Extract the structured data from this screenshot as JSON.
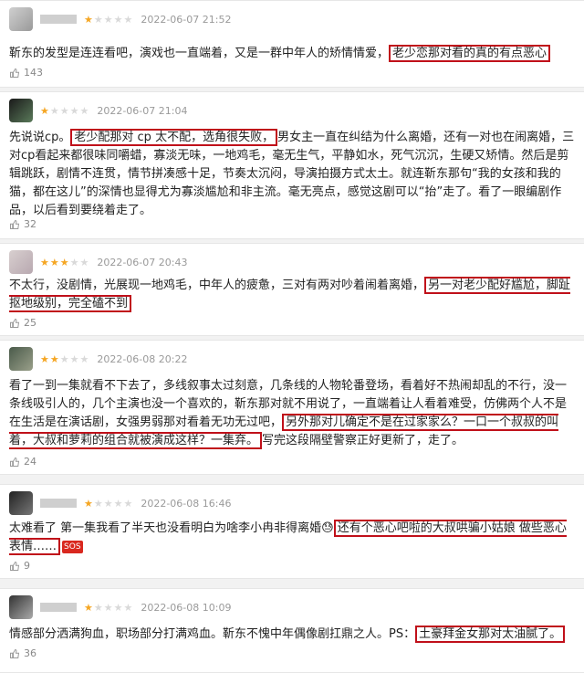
{
  "reviews": [
    {
      "date": "2022-06-07 21:52",
      "rating": 1,
      "text_before": "靳东的发型是连连看吧，演戏也一直端着，又是一群中年人的矫情情爱，",
      "highlight": "老少恋那对看的真的有点恶心",
      "text_after": "",
      "likes": "143"
    },
    {
      "date": "2022-06-07 21:04",
      "rating": 1,
      "text_before": "先说说cp。",
      "highlight": "老少配那对 cp 太不配，选角很失败，",
      "text_after": "男女主一直在纠结为什么离婚，还有一对也在闹离婚，三对cp看起来都很味同嚼蜡，寡淡无味，一地鸡毛，毫无生气，平静如水，死气沉沉，生硬又矫情。然后是剪辑跳跃，剧情不连贯，情节拼凑感十足，节奏太沉闷，导演拍摄方式太土。就连靳东那句“我的女孩和我的猫，都在这儿”的深情也显得尤为寡淡尴尬和非主流。毫无亮点，感觉这剧可以“抬”走了。看了一眼编剧作品，以后看到要绕着走了。",
      "likes": "32"
    },
    {
      "date": "2022-06-07 20:43",
      "rating": 3,
      "text_before": "不太行，没剧情，光展现一地鸡毛，中年人的疲惫，三对有两对吵着闹着离婚，",
      "highlight": "另一对老少配好尴尬，脚趾抠地级别，完全磕不到",
      "text_after": "",
      "likes": "25"
    },
    {
      "date": "2022-06-08 20:22",
      "rating": 2,
      "text_before": "看了一到一集就看不下去了，多线叙事太过刻意，几条线的人物轮番登场，看着好不热闹却乱的不行，没一条线吸引人的，几个主演也没一个喜欢的，靳东那对就不用说了，一直端着让人看着难受，仿佛两个人不是在生活是在演话剧，女强男弱那对看着无功无过吧，",
      "highlight": "另外那对儿确定不是在过家家么？一口一个叔叔的叫着，大叔和萝莉的组合就被演成这样？一集弃。",
      "text_after": "写完这段隔壁警察正好更新了，走了。",
      "likes": "24"
    },
    {
      "date": "2022-06-08 16:46",
      "rating": 1,
      "text_before": "太难看了 第一集我看了半天也没看明白为啥李小冉非得离婚😓",
      "highlight": "还有个恶心吧啦的大叔哄骗小姑娘 做些恶心表情……",
      "text_after": "",
      "sos": "SOS",
      "likes": "9"
    },
    {
      "date": "2022-06-08 10:09",
      "rating": 1,
      "text_before": "情感部分洒满狗血，职场部分打满鸡血。靳东不愧中年偶像剧扛鼎之人。PS：",
      "highlight": "土豪拜金女那对太油腻了。",
      "text_after": "",
      "likes": "36"
    }
  ]
}
